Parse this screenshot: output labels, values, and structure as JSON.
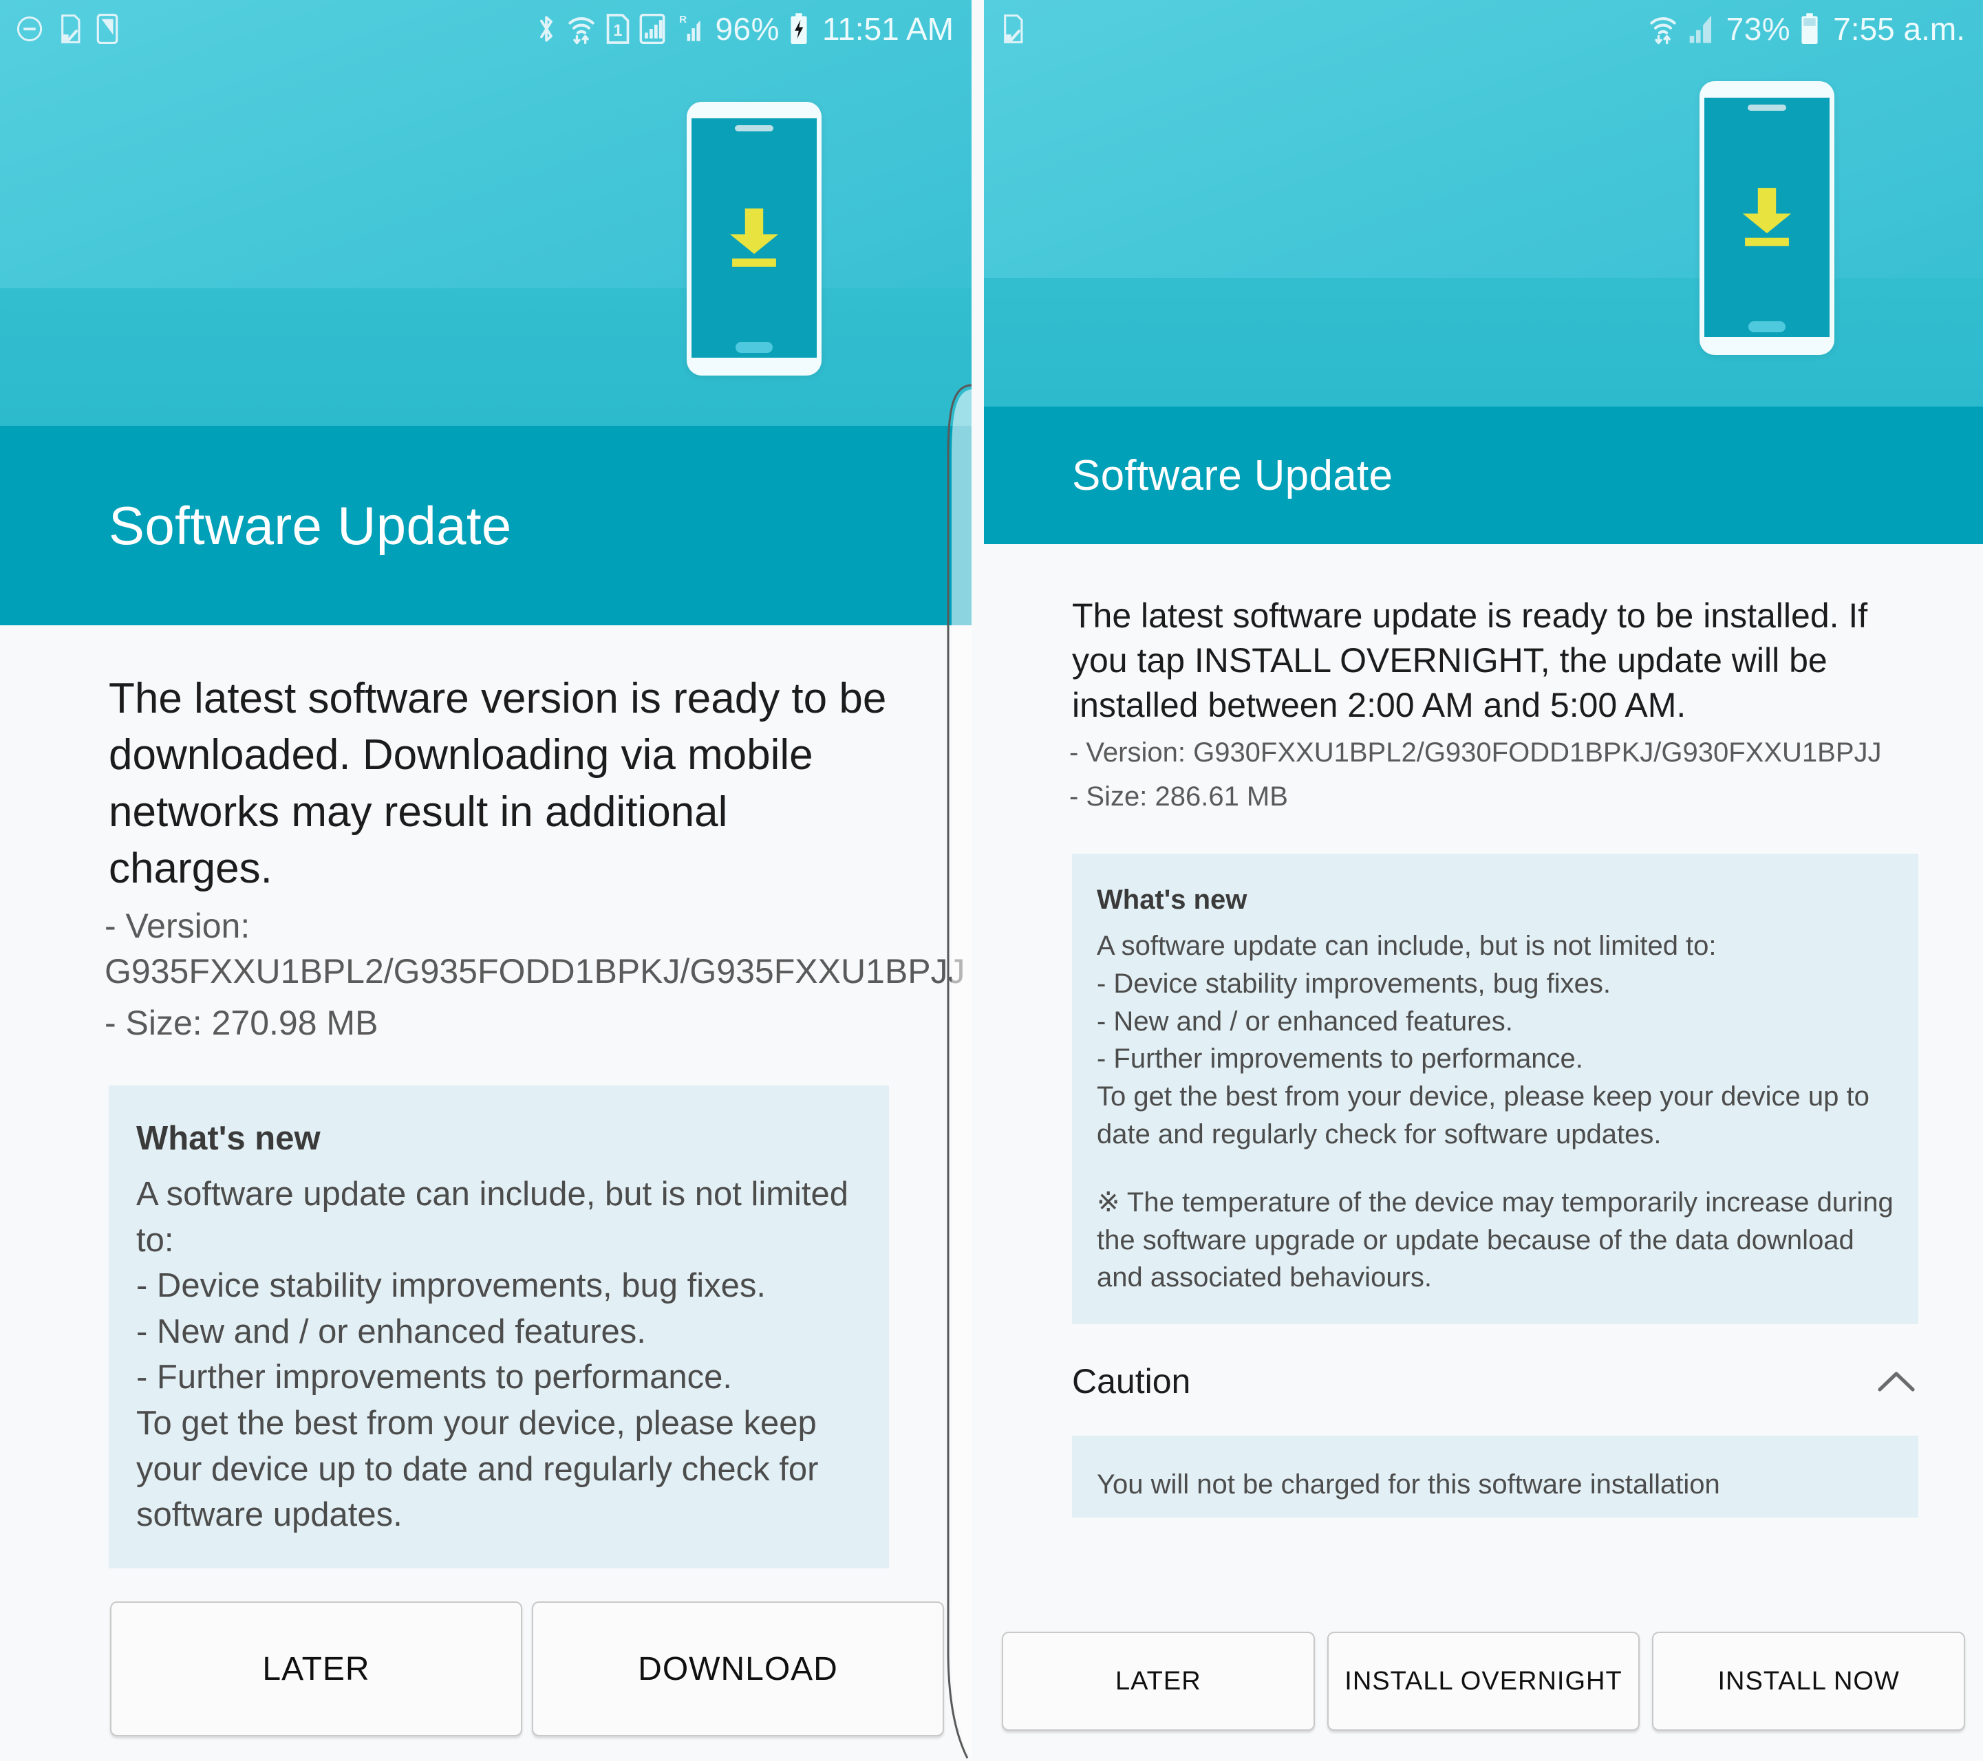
{
  "left_panel": {
    "statusbar": {
      "left_icons": [
        "do-not-disturb-icon",
        "download-complete-icon",
        "screen-mirroring-icon"
      ],
      "right_icons": [
        "bluetooth-icon",
        "wifi-data-icon",
        "sim-1-icon",
        "signal-bars-icon",
        "roaming-signal-icon"
      ],
      "battery_percent": "96%",
      "battery_state": "charging",
      "time": "11:51 AM"
    },
    "hero": {
      "illustration": "phone-download-icon",
      "accent_color": "#00a0b8",
      "arrow_color": "#e9e33f"
    },
    "title": "Software Update",
    "lead": "The latest software version is ready to be downloaded. Downloading via mobile networks may result in additional charges.",
    "version_line": " - Version: G935FXXU1BPL2/G935FODD1BPKJ/G935FXXU1BPJJ",
    "size_line": " - Size: 270.98 MB",
    "whats_new": {
      "title": "What's new",
      "intro": "A software update can include, but is not limited to:",
      "bullets": [
        " - Device stability improvements, bug fixes.",
        " - New and / or enhanced features.",
        " - Further improvements to performance."
      ],
      "outro": "To get the best from your device, please keep your device up to date and regularly check for software updates."
    },
    "buttons": [
      {
        "label": "LATER",
        "name": "later-button"
      },
      {
        "label": "DOWNLOAD",
        "name": "download-button"
      }
    ]
  },
  "right_panel": {
    "statusbar": {
      "left_icons": [
        "download-complete-icon"
      ],
      "right_icons": [
        "wifi-data-icon",
        "signal-bars-icon"
      ],
      "battery_percent": "73%",
      "battery_state": "normal",
      "time": "7:55 a.m."
    },
    "hero": {
      "illustration": "phone-download-icon",
      "accent_color": "#00a0b8",
      "arrow_color": "#e9e33f"
    },
    "title": "Software Update",
    "lead": "The latest software update is ready to be installed. If you tap INSTALL OVERNIGHT, the update will be installed between 2:00 AM and 5:00 AM.",
    "version_line": " - Version: G930FXXU1BPL2/G930FODD1BPKJ/G930FXXU1BPJJ",
    "size_line": " - Size: 286.61 MB",
    "whats_new": {
      "title": "What's new",
      "intro": "A software update can include, but is not limited to:",
      "bullets": [
        " - Device stability improvements, bug fixes.",
        " - New and / or enhanced features.",
        " - Further improvements to performance."
      ],
      "outro": "To get the best from your device, please keep your device up to date and regularly check for software updates.",
      "note": "※ The temperature of the device may temporarily increase during the software upgrade or update because of the data download and associated behaviours."
    },
    "caution": {
      "label": "Caution",
      "expanded": true,
      "chevron": "chevron-up-icon",
      "text": "You will not be charged for this software installation"
    },
    "buttons": [
      {
        "label": "LATER",
        "name": "later-button"
      },
      {
        "label": "INSTALL OVERNIGHT",
        "name": "install-overnight-button"
      },
      {
        "label": "INSTALL NOW",
        "name": "install-now-button"
      }
    ]
  },
  "colors": {
    "hero_top": "#55cfdf",
    "hero_bottom": "#32bccf",
    "titlebar": "#00a0b8",
    "infobox": "#e2eff4",
    "page_bg": "#f8f9fa",
    "arrow_yellow": "#e9e33f"
  }
}
